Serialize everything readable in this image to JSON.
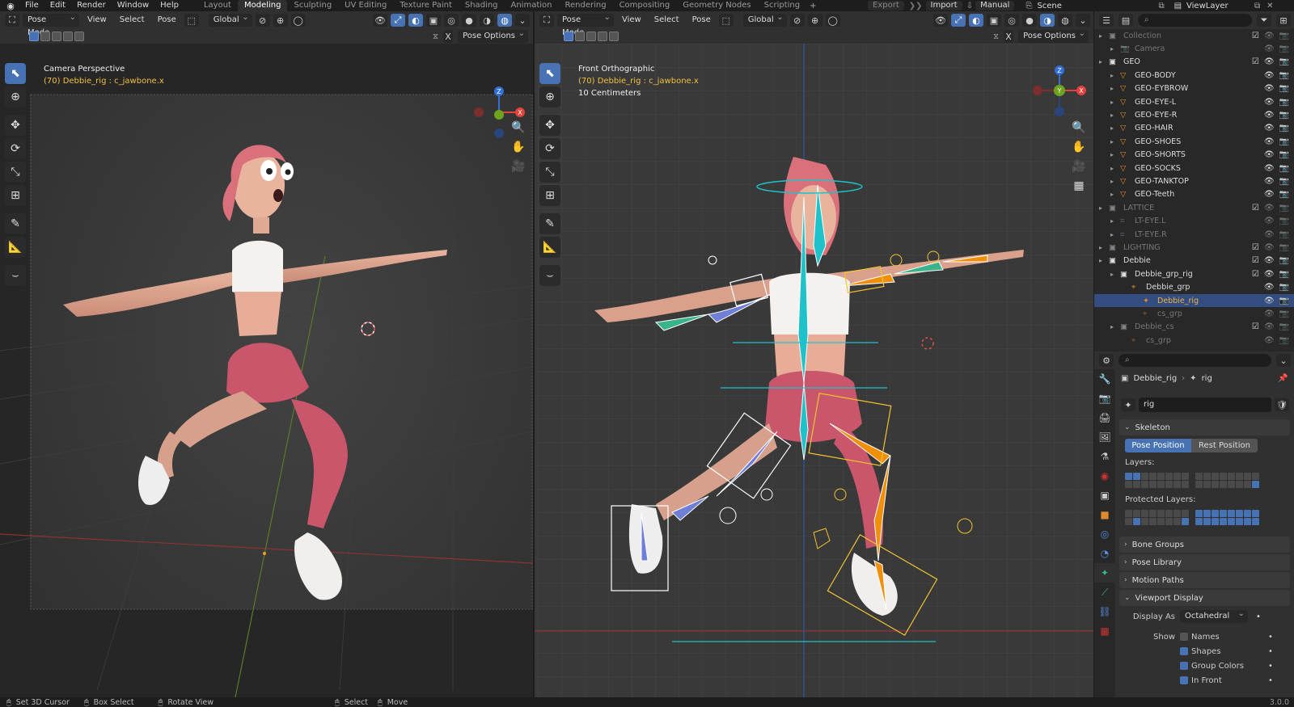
{
  "menu": [
    "File",
    "Edit",
    "Render",
    "Window",
    "Help"
  ],
  "workspaces": [
    {
      "label": "Layout",
      "active": false
    },
    {
      "label": "Modeling",
      "active": true
    },
    {
      "label": "Sculpting",
      "active": false
    },
    {
      "label": "UV Editing",
      "active": false
    },
    {
      "label": "Texture Paint",
      "active": false
    },
    {
      "label": "Shading",
      "active": false
    },
    {
      "label": "Animation",
      "active": false
    },
    {
      "label": "Rendering",
      "active": false
    },
    {
      "label": "Compositing",
      "active": false
    },
    {
      "label": "Geometry Nodes",
      "active": false
    },
    {
      "label": "Scripting",
      "active": false
    }
  ],
  "top_right": {
    "export": "Export",
    "import": "Import",
    "manual": "Manual",
    "scene": "Scene",
    "view_layer": "ViewLayer"
  },
  "left_view": {
    "mode": "Pose Mode",
    "view": "View",
    "select": "Select",
    "pose": "Pose",
    "orientation": "Global",
    "pose_options": "Pose Options",
    "title": "Camera Perspective",
    "subtitle": "(70) Debbie_rig : c_jawbone.x"
  },
  "right_view": {
    "mode": "Pose Mode",
    "view": "View",
    "select": "Select",
    "pose": "Pose",
    "orientation": "Global",
    "pose_options": "Pose Options",
    "title": "Front Orthographic",
    "subtitle": "(70) Debbie_rig : c_jawbone.x",
    "scale": "10 Centimeters"
  },
  "axes": {
    "x": "X",
    "y": "Y",
    "z": "Z"
  },
  "outliner": [
    {
      "label": "Collection",
      "depth": 0,
      "kind": "collection",
      "dim": true
    },
    {
      "label": "Camera",
      "depth": 1,
      "kind": "camera",
      "dim": true
    },
    {
      "label": "GEO",
      "depth": 0,
      "kind": "collection",
      "dim": false
    },
    {
      "label": "GEO-BODY",
      "depth": 1,
      "kind": "mesh",
      "dim": false
    },
    {
      "label": "GEO-EYBROW",
      "depth": 1,
      "kind": "mesh",
      "dim": false
    },
    {
      "label": "GEO-EYE-L",
      "depth": 1,
      "kind": "mesh",
      "dim": false
    },
    {
      "label": "GEO-EYE-R",
      "depth": 1,
      "kind": "mesh",
      "dim": false
    },
    {
      "label": "GEO-HAIR",
      "depth": 1,
      "kind": "mesh",
      "dim": false
    },
    {
      "label": "GEO-SHOES",
      "depth": 1,
      "kind": "mesh",
      "dim": false
    },
    {
      "label": "GEO-SHORTS",
      "depth": 1,
      "kind": "mesh",
      "dim": false
    },
    {
      "label": "GEO-SOCKS",
      "depth": 1,
      "kind": "mesh",
      "dim": false
    },
    {
      "label": "GEO-TANKTOP",
      "depth": 1,
      "kind": "mesh",
      "dim": false
    },
    {
      "label": "GEO-Teeth",
      "depth": 1,
      "kind": "mesh",
      "dim": false
    },
    {
      "label": "LATTICE",
      "depth": 0,
      "kind": "collection",
      "dim": true
    },
    {
      "label": "LT-EYE.L",
      "depth": 1,
      "kind": "lattice",
      "dim": true
    },
    {
      "label": "LT-EYE.R",
      "depth": 1,
      "kind": "lattice",
      "dim": true
    },
    {
      "label": "LIGHTING",
      "depth": 0,
      "kind": "collection",
      "dim": true
    },
    {
      "label": "Debbie",
      "depth": 0,
      "kind": "collection",
      "dim": false
    },
    {
      "label": "Debbie_grp_rig",
      "depth": 1,
      "kind": "collection",
      "dim": false
    },
    {
      "label": "Debbie_grp",
      "depth": 2,
      "kind": "empty",
      "dim": false
    },
    {
      "label": "Debbie_rig",
      "depth": 3,
      "kind": "armature",
      "dim": false,
      "selected": true
    },
    {
      "label": "cs_grp",
      "depth": 3,
      "kind": "empty",
      "dim": true
    },
    {
      "label": "Debbie_cs",
      "depth": 1,
      "kind": "collection",
      "dim": true
    },
    {
      "label": "cs_grp",
      "depth": 2,
      "kind": "empty",
      "dim": true
    }
  ],
  "properties": {
    "breadcrumb_object": "Debbie_rig",
    "breadcrumb_data": "rig",
    "data_name": "rig",
    "skeleton": "Skeleton",
    "pose_position": "Pose Position",
    "rest_position": "Rest Position",
    "layers": "Layers:",
    "protected_layers": "Protected Layers:",
    "bone_groups": "Bone Groups",
    "pose_library": "Pose Library",
    "motion_paths": "Motion Paths",
    "viewport_display": "Viewport Display",
    "display_as_label": "Display As",
    "display_as": "Octahedral",
    "show_label": "Show",
    "names": "Names",
    "shapes": "Shapes",
    "group_colors": "Group Colors",
    "in_front": "In Front"
  },
  "status": {
    "set_cursor": "Set 3D Cursor",
    "box_select": "Box Select",
    "rotate_view": "Rotate View",
    "select": "Select",
    "move": "Move",
    "version": "3.0.0"
  },
  "colors": {
    "accent": "#4772b3",
    "selection": "#334d80",
    "axis_x": "#e2433c",
    "axis_y": "#6ea320",
    "axis_z": "#2f6fd6",
    "bone_orange": "#f0900a",
    "bone_blue": "#6f7fd8",
    "bone_cyan": "#1fc2c8",
    "bone_green": "#38b38a",
    "yellow_shape": "#f0c430"
  }
}
